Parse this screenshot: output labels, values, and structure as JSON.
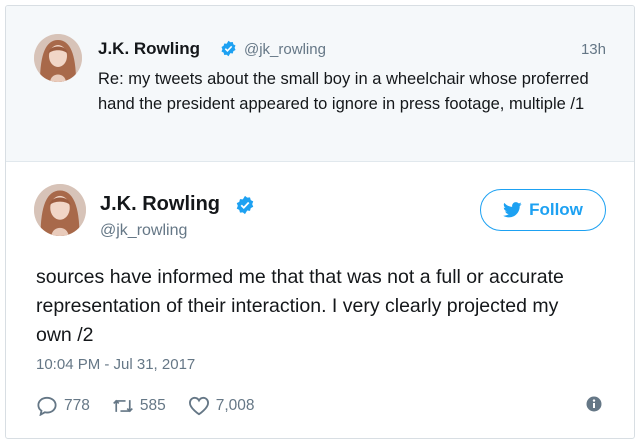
{
  "parent_tweet": {
    "author": "J.K. Rowling",
    "handle": "@jk_rowling",
    "time": "13h",
    "text": "Re: my tweets about the small boy in a wheelchair whose proferred hand the president appeared to ignore in press footage, multiple /1"
  },
  "main_tweet": {
    "author": "J.K. Rowling",
    "handle": "@jk_rowling",
    "follow_label": "Follow",
    "text": "sources have informed me that that was not a full or accurate representation of their interaction. I very clearly projected my own /2",
    "timestamp": "10:04 PM - Jul 31, 2017",
    "replies": "778",
    "retweets": "585",
    "likes": "7,008"
  },
  "colors": {
    "accent": "#1da1f2",
    "text": "#14171a",
    "muted": "#657786",
    "parent_bg": "#f5f8fa"
  },
  "icons": {
    "verified": "verified-badge-icon",
    "bird": "twitter-bird-icon",
    "reply": "reply-icon",
    "retweet": "retweet-icon",
    "like": "heart-icon",
    "info": "info-icon"
  }
}
